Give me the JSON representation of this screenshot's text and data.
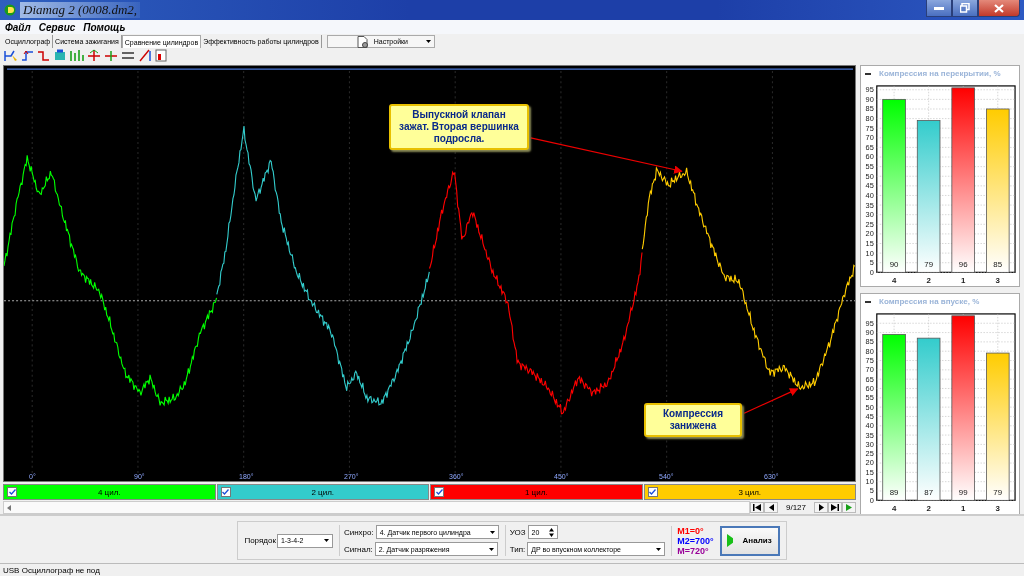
{
  "window": {
    "title": "Diamag 2 (0008.dm2,"
  },
  "menu": [
    {
      "label": "Файл"
    },
    {
      "label": "Сервис"
    },
    {
      "label": "Помощь"
    }
  ],
  "tabs": [
    {
      "label": "Осциллограф",
      "selected": false
    },
    {
      "label": "Система зажигания",
      "selected": false
    },
    {
      "label": "Сравнение цилиндров",
      "selected": true
    },
    {
      "label": "Эффективность работы цилиндров",
      "selected": false
    }
  ],
  "settings_dropdown": {
    "label": "Настройки"
  },
  "oscillogram": {
    "x_labels": [
      "0°",
      "90°",
      "180°",
      "270°",
      "360°",
      "450°",
      "540°",
      "630°"
    ],
    "callouts": [
      {
        "text": "Выпускной клапан зажат. Вторая вершинка подросла."
      },
      {
        "text": "Компрессия занижена"
      }
    ]
  },
  "cylinders": [
    {
      "label": "4 цил.",
      "checked": true,
      "color": "#00ff00"
    },
    {
      "label": "2 цил.",
      "checked": true,
      "color": "#33cccc"
    },
    {
      "label": "1 цил.",
      "checked": true,
      "color": "#ff0000"
    },
    {
      "label": "3 цил.",
      "checked": true,
      "color": "#ffcc00"
    }
  ],
  "navigator": {
    "counter": "9/127"
  },
  "panels": [
    {
      "chart_data": {
        "type": "bar",
        "title": "Компрессия на перекрытии, %",
        "categories": [
          "4",
          "2",
          "1",
          "3"
        ],
        "values": [
          90,
          79,
          96,
          85
        ],
        "ylim": [
          0,
          97
        ],
        "grid": true,
        "yticks": [
          0,
          5,
          10,
          15,
          20,
          25,
          30,
          35,
          40,
          45,
          50,
          55,
          60,
          65,
          70,
          75,
          80,
          85,
          90,
          95
        ],
        "data_labels": true
      }
    },
    {
      "chart_data": {
        "type": "bar",
        "title": "Компрессия на впуске, %",
        "categories": [
          "4",
          "2",
          "1",
          "3"
        ],
        "values": [
          89,
          87,
          99,
          79
        ],
        "ylim": [
          0,
          100
        ],
        "grid": true,
        "yticks": [
          0,
          5,
          10,
          15,
          20,
          25,
          30,
          35,
          40,
          45,
          50,
          55,
          60,
          65,
          70,
          75,
          80,
          85,
          90,
          95
        ],
        "data_labels": true
      }
    }
  ],
  "controls": {
    "order_label": "Порядок",
    "order": "1-3-4-2",
    "sync_label": "Синхро:",
    "sync": "4. Датчик первого цилиндра",
    "signal_label": "Сигнал:",
    "signal": "2. Датчик разряжения",
    "uoz_label": "УОЗ",
    "uoz": "20",
    "type_label": "Тип:",
    "type": "ДР во впускном коллекторе",
    "markers": [
      {
        "text": "M1=0°",
        "color": "#ff0000"
      },
      {
        "text": "M2=700°",
        "color": "#0000ff"
      },
      {
        "text": "M=720°",
        "color": "#990099"
      }
    ],
    "analyze_button": "Анализ"
  },
  "status_bar": {
    "text": "USB Осциллограф не под"
  }
}
